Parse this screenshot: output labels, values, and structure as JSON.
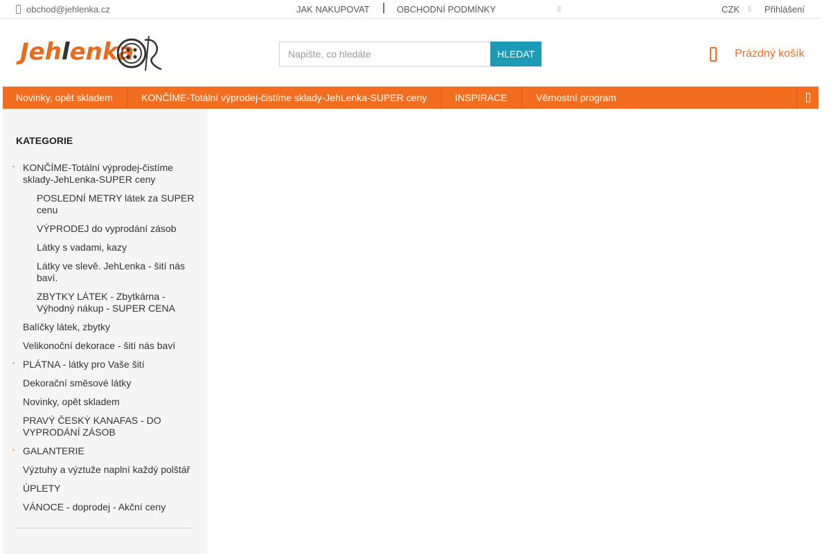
{
  "topbar": {
    "email": "obchod@jehlenka.cz",
    "links": [
      "JAK NAKUPOVAT",
      "OBCHODNÍ PODMÍNKY"
    ],
    "separator": "|",
    "currency": "CZK",
    "login": "Přihlášení"
  },
  "header": {
    "logo_text_a": "Jeh",
    "logo_text_b": "l",
    "logo_text_c": "enka",
    "search_placeholder": "Napište, co hledáte",
    "search_button": "HLEDAT",
    "cart_label": "Prázdný košík"
  },
  "nav": {
    "tabs": [
      "Novinky, opět skladem",
      "KONČÍME-Totální výprodej-čistíme sklady-JehLenka-SUPER ceny",
      "INSPIRACE",
      "Věrnostní program"
    ]
  },
  "sidebar": {
    "title": "KATEGORIE",
    "items": [
      {
        "label": "KONČÍME-Totální výprodej-čistíme sklady-JehLenka-SUPER ceny",
        "level": 1,
        "bullet": true
      },
      {
        "label": "POSLEDNÍ METRY látek za SUPER cenu",
        "level": 2,
        "bullet": false
      },
      {
        "label": "VÝPRODEJ do vyprodání zásob",
        "level": 2,
        "bullet": false
      },
      {
        "label": "Látky s vadami, kazy",
        "level": 2,
        "bullet": false
      },
      {
        "label": "Látky ve slevě. JehLenka - šití nás baví.",
        "level": 2,
        "bullet": false
      },
      {
        "label": "ZBYTKY LÁTEK - Zbytkárna - Výhodný nákup - SUPER CENA",
        "level": 2,
        "bullet": false
      },
      {
        "label": "Balíčky látek, zbytky",
        "level": 1,
        "bullet": false
      },
      {
        "label": "Velikonoční dekorace - šití nás baví",
        "level": 1,
        "bullet": false
      },
      {
        "label": "PLÁTNA - látky pro Vaše šití",
        "level": 1,
        "bullet": true
      },
      {
        "label": "Dekorační směsové látky",
        "level": 1,
        "bullet": false
      },
      {
        "label": "Novinky, opět skladem",
        "level": 1,
        "bullet": false
      },
      {
        "label": "PRAVÝ ČESKÝ KANAFAS - DO VYPRODÁNÍ ZÁSOB",
        "level": 1,
        "bullet": false
      },
      {
        "label": "GALANTERIE",
        "level": 1,
        "bullet": true
      },
      {
        "label": "Výztuhy a výztuže naplní každý polštář",
        "level": 1,
        "bullet": false
      },
      {
        "label": "ÚPLETY",
        "level": 1,
        "bullet": false
      },
      {
        "label": "VÁNOCE - doprodej - Akční ceny",
        "level": 1,
        "bullet": false
      }
    ]
  },
  "colors": {
    "accent": "#f26e1e",
    "search_button": "#1c9ab6",
    "sidebar_bg": "#f5f5f5"
  }
}
